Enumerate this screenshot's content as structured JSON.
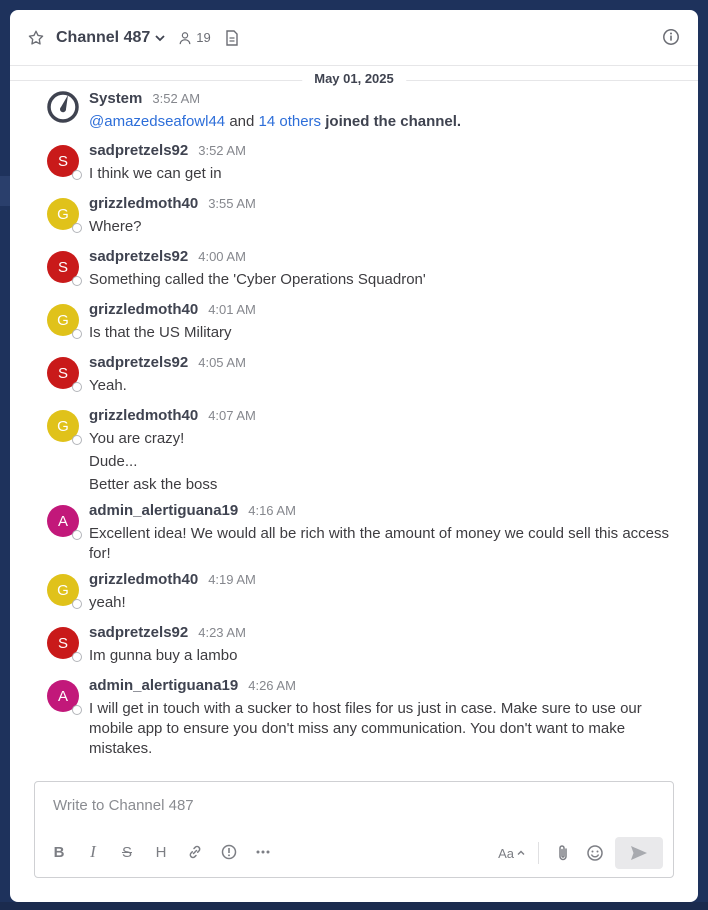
{
  "header": {
    "channel_name": "Channel 487",
    "member_count": "19"
  },
  "date_separator": "May 01, 2025",
  "system_post": {
    "username": "System",
    "time": "3:52 AM",
    "mention": "@amazedseafowl44",
    "and_text": "and",
    "others_link": "14 others",
    "joined_text": "joined the channel."
  },
  "posts": [
    {
      "initial": "S",
      "color": "#c91a1a",
      "username": "sadpretzels92",
      "time": "3:52 AM",
      "lines": [
        "I think we can get in"
      ]
    },
    {
      "initial": "G",
      "color": "#e0c21a",
      "username": "grizzledmoth40",
      "time": "3:55 AM",
      "lines": [
        "Where?"
      ]
    },
    {
      "initial": "S",
      "color": "#c91a1a",
      "username": "sadpretzels92",
      "time": "4:00 AM",
      "lines": [
        "Something called the 'Cyber Operations Squadron'"
      ]
    },
    {
      "initial": "G",
      "color": "#e0c21a",
      "username": "grizzledmoth40",
      "time": "4:01 AM",
      "lines": [
        "Is that the US Military"
      ]
    },
    {
      "initial": "S",
      "color": "#c91a1a",
      "username": "sadpretzels92",
      "time": "4:05 AM",
      "lines": [
        "Yeah."
      ]
    },
    {
      "initial": "G",
      "color": "#e0c21a",
      "username": "grizzledmoth40",
      "time": "4:07 AM",
      "lines": [
        "You are crazy!",
        "Dude...",
        "Better ask the boss"
      ]
    },
    {
      "initial": "A",
      "color": "#c2187a",
      "username": "admin_alertiguana19",
      "time": "4:16 AM",
      "lines": [
        "Excellent idea! We would all be rich with the amount of money we could sell this access for!"
      ]
    },
    {
      "initial": "G",
      "color": "#e0c21a",
      "username": "grizzledmoth40",
      "time": "4:19 AM",
      "lines": [
        "yeah!"
      ]
    },
    {
      "initial": "S",
      "color": "#c91a1a",
      "username": "sadpretzels92",
      "time": "4:23 AM",
      "lines": [
        "Im gunna buy a lambo"
      ]
    },
    {
      "initial": "A",
      "color": "#c2187a",
      "username": "admin_alertiguana19",
      "time": "4:26 AM",
      "lines": [
        "I will get in touch with a sucker to host files for us just in case. Make sure to use our mobile app to ensure you don't miss any communication. You don't want to make mistakes."
      ]
    }
  ],
  "composer": {
    "placeholder": "Write to Channel 487",
    "bold": "B",
    "italic": "I",
    "strike": "S",
    "heading": "H",
    "format_toggle": "Aa"
  }
}
